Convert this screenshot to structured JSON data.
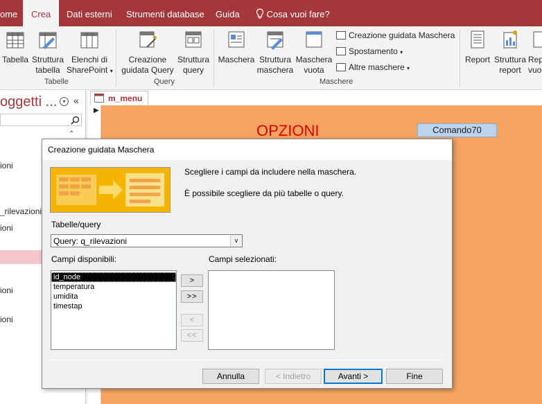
{
  "ribbon_tabs": {
    "home": "ome",
    "create": "Crea",
    "external": "Dati esterni",
    "dbtools": "Strumenti database",
    "help": "Guida",
    "tellme": "Cosa vuoi fare?"
  },
  "ribbon": {
    "tabelle": {
      "label": "Tabelle",
      "tabella": "Tabella",
      "struttura_l1": "Struttura",
      "struttura_l2": "tabella",
      "elenchi_l1": "Elenchi di",
      "elenchi_l2": "SharePoint"
    },
    "query": {
      "label": "Query",
      "creazione_l1": "Creazione",
      "creazione_l2": "guidata Query",
      "struttura_l1": "Struttura",
      "struttura_l2": "query"
    },
    "maschere": {
      "label": "Maschere",
      "maschera": "Maschera",
      "struttura_l1": "Struttura",
      "struttura_l2": "maschera",
      "vuota_l1": "Maschera",
      "vuota_l2": "vuota",
      "creazione_guidata": "Creazione guidata Maschera",
      "spostamento": "Spostamento",
      "altre": "Altre maschere"
    },
    "report": {
      "report": "Report",
      "struttura_l1": "Struttura",
      "struttura_l2": "report",
      "rep_l1": "Rep",
      "rep_l2": "vuo"
    }
  },
  "nav": {
    "title": "oggetti ...",
    "items": [
      "ioni",
      "_rilevazioni",
      "ioni",
      "ioni",
      "ioni"
    ]
  },
  "document": {
    "tab": "m_menu",
    "heading": "OPZIONI",
    "command_button": "Comando70"
  },
  "dialog": {
    "title": "Creazione guidata Maschera",
    "instruction1": "Scegliere i campi da includere nella maschera.",
    "instruction2": "È possibile scegliere da più tabelle o query.",
    "tables_label": "Tabelle/query",
    "tables_value": "Query: q_rilevazioni",
    "available_label": "Campi disponibili:",
    "selected_label": "Campi selezionati:",
    "available_fields": [
      "id_node",
      "temperatura",
      "umidita",
      "timestap"
    ],
    "move_one": ">",
    "move_all": ">>",
    "remove_one": "<",
    "remove_all": "<<",
    "cancel": "Annulla",
    "back": "< Indietro",
    "next": "Avanti >",
    "finish": "Fine"
  },
  "colors": {
    "accent": "#a4373a",
    "form_bg": "#f4a460",
    "heading": "#e00000"
  }
}
